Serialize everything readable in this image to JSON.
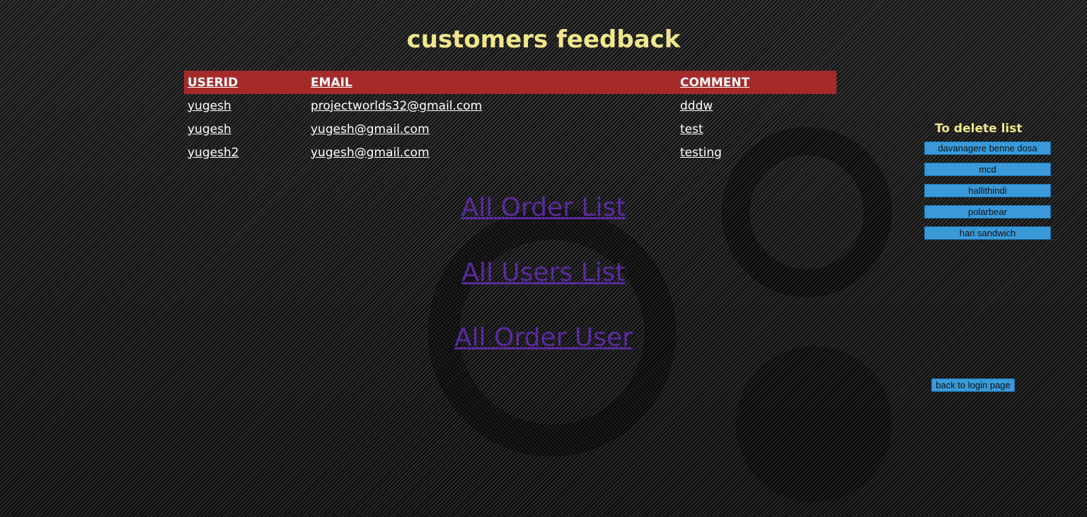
{
  "page": {
    "title": "customers feedback"
  },
  "table": {
    "headers": [
      "USERID",
      "EMAIL",
      "COMMENT"
    ],
    "rows": [
      [
        "yugesh",
        "projectworlds32@gmail.com",
        "dddw"
      ],
      [
        "yugesh",
        "yugesh@gmail.com",
        "test"
      ],
      [
        "yugesh2",
        "yugesh@gmail.com",
        "testing"
      ]
    ]
  },
  "nav": {
    "all_order_list": "All Order List",
    "all_users_list": "All Users List",
    "all_order_user": "All Order User"
  },
  "sidebar": {
    "title": "To delete list",
    "items": [
      "davanagere benne dosa",
      "mcd",
      "hallithindi",
      "polarbear",
      "hari sandwich"
    ],
    "back_button": "back to login page"
  },
  "colors": {
    "title": "#f0e68c",
    "header_bg": "#a52a2a",
    "link": "#5b2a9e",
    "button": "#3a9ad9"
  }
}
